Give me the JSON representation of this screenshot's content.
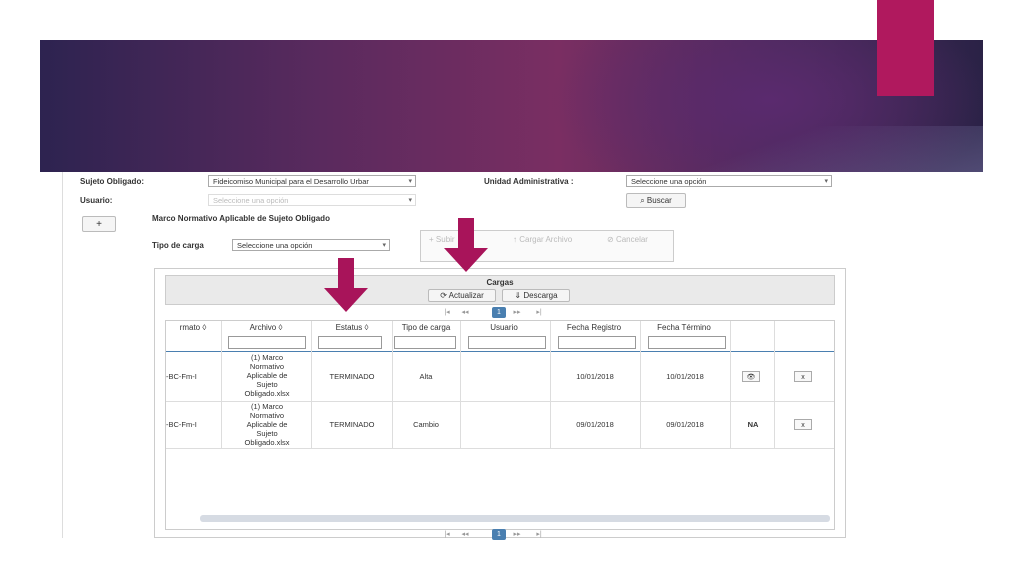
{
  "form": {
    "sujeto_label": "Sujeto Obligado:",
    "sujeto_value": "Fideicomiso Municipal para el Desarrollo Urbar",
    "unidad_label": "Unidad Administrativa :",
    "unidad_value": "Seleccione una opción",
    "usuario_label": "Usuario:",
    "usuario_placeholder": "Seleccione una opción",
    "buscar_label": "Buscar",
    "plus_label": "+",
    "marco_title": "Marco Normativo Aplicable de Sujeto Obligado",
    "tipo_carga_label": "Tipo de carga",
    "tipo_carga_value": "Seleccione una opción"
  },
  "toolbar": {
    "subir_label": "Subir",
    "cargar_label": "Cargar Archivo",
    "cancelar_label": "Cancelar"
  },
  "panel": {
    "title": "Cargas",
    "actualizar_label": "Actualizar",
    "descarga_label": "Descarga",
    "page": "1"
  },
  "table": {
    "headers": [
      "rmato",
      "Archivo",
      "Estatus",
      "Tipo de carga",
      "Usuario",
      "Fecha Registro",
      "Fecha Término"
    ],
    "rows": [
      {
        "formato": "-BC-Fm-I",
        "archivo": "(1) Marco Normativo Aplicable de Sujeto Obligado.xlsx",
        "estatus": "TERMINADO",
        "tipo": "Alta",
        "usuario": "",
        "fecha_registro": "10/01/2018",
        "fecha_termino": "10/01/2018",
        "accion": "👁",
        "eliminar": "x"
      },
      {
        "formato": "-BC-Fm-I",
        "archivo": "(1) Marco Normativo Aplicable de Sujeto Obligado.xlsx",
        "estatus": "TERMINADO",
        "tipo": "Cambio",
        "usuario": "",
        "fecha_registro": "09/01/2018",
        "fecha_termino": "09/01/2018",
        "accion": "NA",
        "eliminar": "x"
      }
    ]
  },
  "colors": {
    "accent": "#b0195e",
    "arrow": "#a8145a",
    "pager_active": "#4a7fb0"
  }
}
